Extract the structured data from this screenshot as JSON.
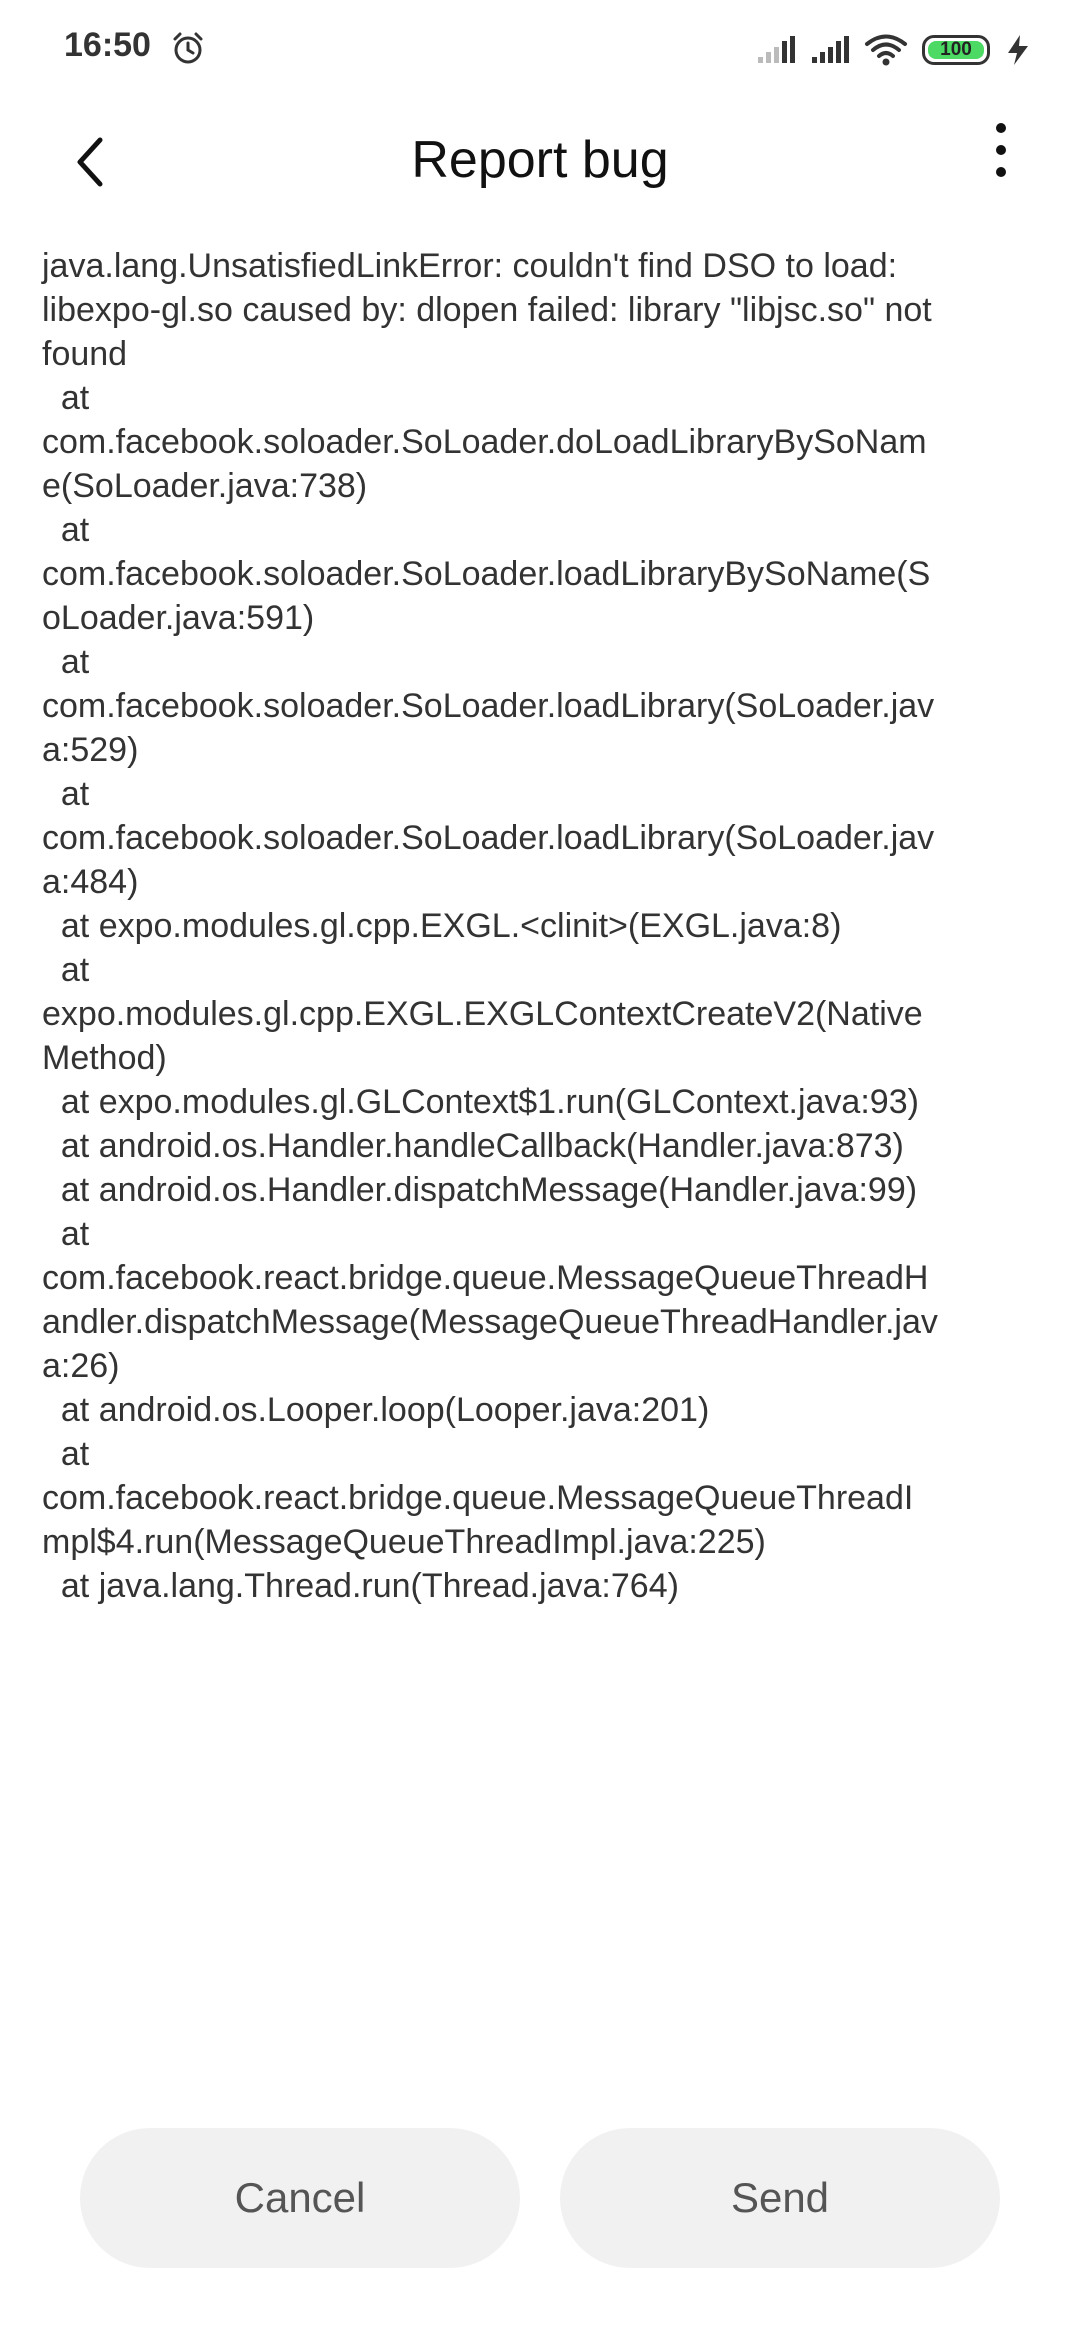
{
  "status_bar": {
    "time": "16:50",
    "battery": "100",
    "battery_level": 1.0,
    "icons": [
      "alarm-clock-icon",
      "signal-icon",
      "signal-icon",
      "wifi-icon",
      "battery-icon",
      "charging-bolt-icon"
    ]
  },
  "header": {
    "title": "Report bug",
    "back_icon": "chevron-left-icon",
    "menu_icon": "more-vertical-icon"
  },
  "trace_lines": [
    "java.lang.UnsatisfiedLinkError: couldn't find DSO to load:",
    "libexpo-gl.so caused by: dlopen failed: library \"libjsc.so\" not",
    "found",
    "  at",
    "com.facebook.soloader.SoLoader.doLoadLibraryBySoNam",
    "e(SoLoader.java:738)",
    "  at",
    "com.facebook.soloader.SoLoader.loadLibraryBySoName(S",
    "oLoader.java:591)",
    "  at",
    "com.facebook.soloader.SoLoader.loadLibrary(SoLoader.jav",
    "a:529)",
    "  at",
    "com.facebook.soloader.SoLoader.loadLibrary(SoLoader.jav",
    "a:484)",
    "  at expo.modules.gl.cpp.EXGL.<clinit>(EXGL.java:8)",
    "  at",
    "expo.modules.gl.cpp.EXGL.EXGLContextCreateV2(Native",
    "Method)",
    "  at expo.modules.gl.GLContext$1.run(GLContext.java:93)",
    "  at android.os.Handler.handleCallback(Handler.java:873)",
    "  at android.os.Handler.dispatchMessage(Handler.java:99)",
    "  at",
    "com.facebook.react.bridge.queue.MessageQueueThreadH",
    "andler.dispatchMessage(MessageQueueThreadHandler.jav",
    "a:26)",
    "  at android.os.Looper.loop(Looper.java:201)",
    "  at",
    "com.facebook.react.bridge.queue.MessageQueueThreadI",
    "mpl$4.run(MessageQueueThreadImpl.java:225)",
    "  at java.lang.Thread.run(Thread.java:764)"
  ],
  "actions": {
    "cancel_label": "Cancel",
    "send_label": "Send"
  },
  "colors": {
    "battery_fill": "#4cd964",
    "button_bg": "#f1f1f1",
    "button_text": "#555555"
  }
}
